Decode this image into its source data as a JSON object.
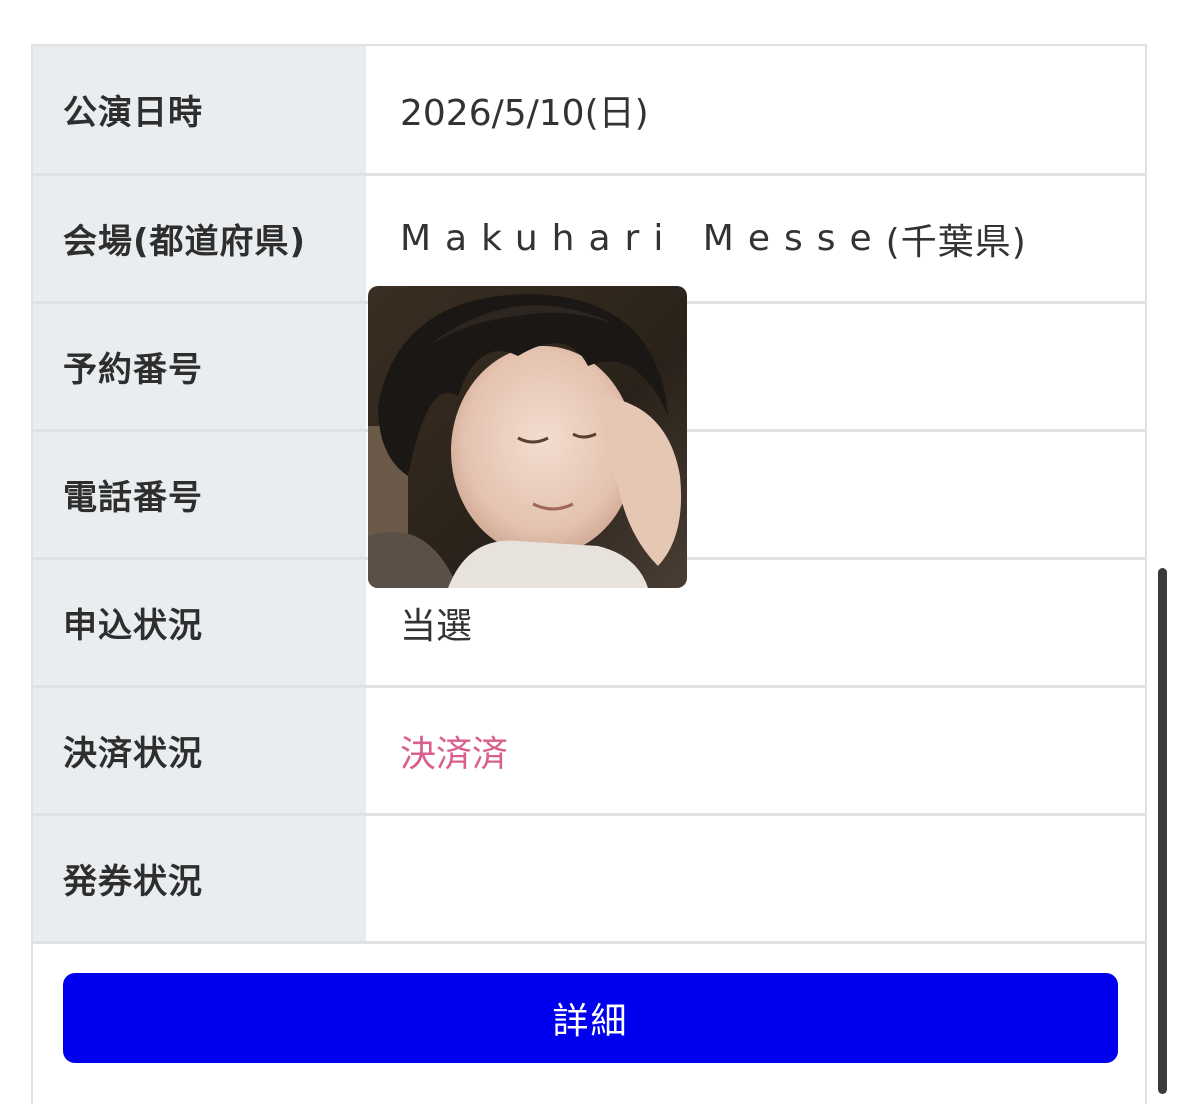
{
  "rows": [
    {
      "label": "公演日時",
      "value": "2026/5/10(日)"
    },
    {
      "label": "会場(都道府県)",
      "value": "Makuhari Messe",
      "pref": "(千葉県)"
    },
    {
      "label": "予約番号",
      "value": ""
    },
    {
      "label": "電話番号",
      "value": ""
    },
    {
      "label": "申込状況",
      "value": "当選"
    },
    {
      "label": "決済状況",
      "value": "決済済"
    },
    {
      "label": "発券状況",
      "value": ""
    }
  ],
  "detail_button": "詳細",
  "colors": {
    "button": "#0000ee",
    "paid_status": "#d9608e",
    "label_bg": "#e9edef"
  }
}
